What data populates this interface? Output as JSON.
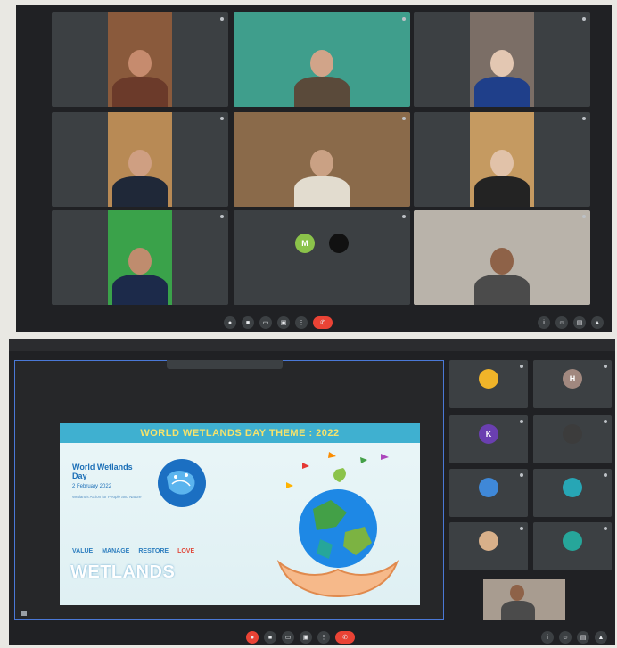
{
  "meet_top": {
    "participants": [
      {
        "name": "",
        "bg": "#8a5a3c",
        "skin": "#c68b6e",
        "cloth": "#6b3a2a"
      },
      {
        "name": "",
        "bg": "#3f9e8c",
        "skin": "#d1a489",
        "cloth": "#5a4a3a"
      },
      {
        "name": "",
        "bg": "#7b6e66",
        "skin": "#e3c7b2",
        "cloth": "#1f3f8a"
      },
      {
        "name": "",
        "bg": "#b88a55",
        "skin": "#cf9f82",
        "cloth": "#1f2838"
      },
      {
        "name": "",
        "bg": "#8a6a4a",
        "skin": "#caa184",
        "cloth": "#e2dccf"
      },
      {
        "name": "",
        "bg": "#c59a61",
        "skin": "#e1c2a9",
        "cloth": "#232323"
      },
      {
        "name": "",
        "bg": "#3aa24a",
        "skin": "#bf8c6e",
        "cloth": "#1c2a4a"
      },
      {
        "name": "",
        "avatar_letter": "M",
        "avatar_color": "#8bc34a"
      },
      {
        "name": "",
        "bg": "#b9b3aa",
        "skin": "#8e6248",
        "cloth": "#4b4b4b"
      }
    ],
    "footer_time": "",
    "end_call_icon": "phone-hangup-icon"
  },
  "meet_bottom": {
    "window_title": "",
    "presenting_text": "",
    "slide": {
      "banner": "WORLD WETLANDS DAY THEME : 2022",
      "event_title": "World Wetlands Day",
      "event_date": "2 February 2022",
      "tagline": "Wetlands Action for People and Nature",
      "actions": [
        "VALUE",
        "MANAGE",
        "RESTORE",
        "LOVE"
      ],
      "big_word": "WETLANDS"
    },
    "side_participants": [
      {
        "name": "",
        "avatar_color": "#f0b429",
        "letter": ""
      },
      {
        "name": "",
        "avatar_color": "#a1887f",
        "letter": "H"
      },
      {
        "name": "",
        "avatar_color": "#6a3fb0",
        "letter": "K"
      },
      {
        "name": "",
        "avatar_color": "#3c3c3c",
        "letter": ""
      },
      {
        "name": "",
        "avatar_color": "#3f88d8",
        "letter": ""
      },
      {
        "name": "",
        "avatar_color": "#27a6b5",
        "letter": ""
      },
      {
        "name": "",
        "avatar_color": "#d8b08a",
        "letter": ""
      },
      {
        "name": "",
        "avatar_color": "#26a69a",
        "letter": ""
      }
    ],
    "end_call_icon": "phone-hangup-icon"
  }
}
